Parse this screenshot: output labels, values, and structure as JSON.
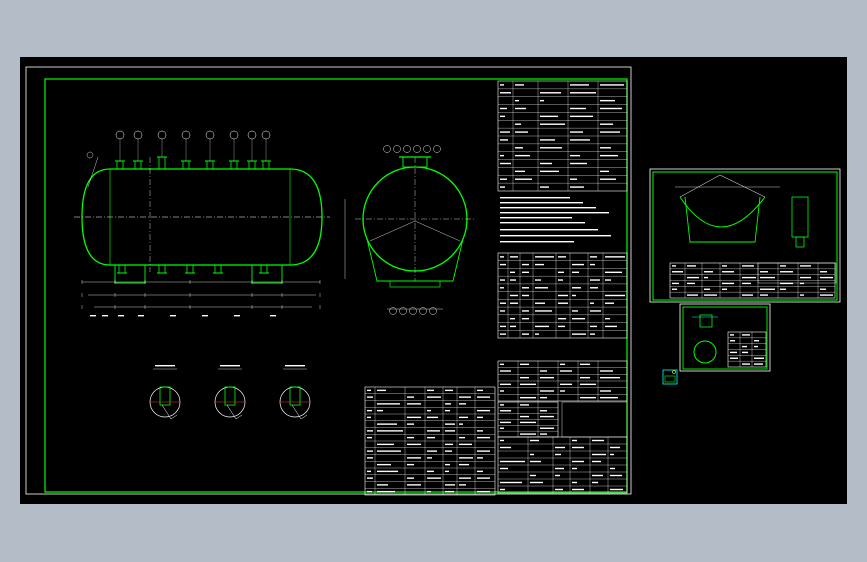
{
  "drawing": {
    "header_note": "",
    "colors": {
      "background": "#b4bcc8",
      "model_space": "#000000",
      "frame": "#ffffff",
      "border": "#00ff00",
      "vessel": "#00ff00",
      "dim": "#ffffff",
      "table_line": "#ffffff",
      "accent_cyan": "#00ffff",
      "accent_red": "#ff3030",
      "accent_yellow": "#ffff00"
    },
    "main_sheet": {
      "title_block_code": "",
      "notes_title": ""
    }
  }
}
